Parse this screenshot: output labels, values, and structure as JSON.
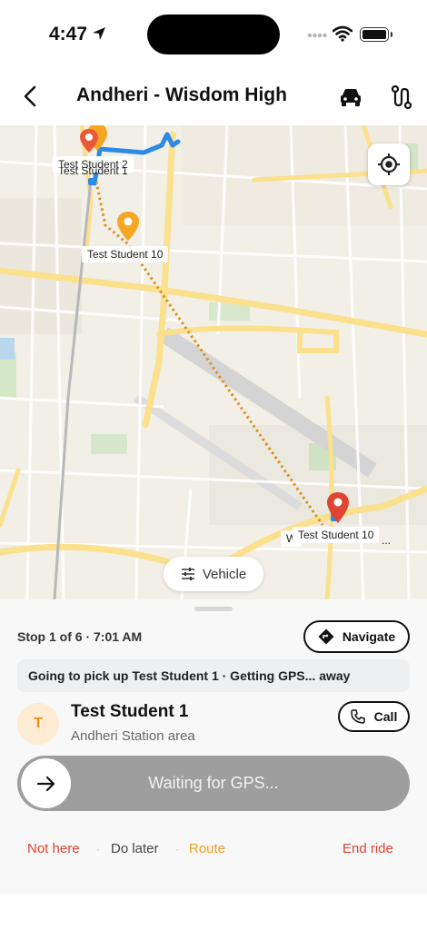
{
  "status_bar": {
    "time": "4:47"
  },
  "header": {
    "title": "Andheri - Wisdom High"
  },
  "map": {
    "labels": [
      "Test Student 2",
      "Test Student 1",
      "Test Student 10",
      "Test Student 10",
      "W",
      "..."
    ],
    "vehicle_chip": "Vehicle",
    "colors": {
      "route_blue": "#2a8ae6",
      "dotted_route": "#d9901f",
      "pin_orange": "#f5a623",
      "pin_red": "#e04432"
    }
  },
  "sheet": {
    "stop_info": "Stop 1 of 6 · 7:01 AM",
    "navigate_label": "Navigate",
    "banner": "Going to pick up Test Student 1 · Getting GPS... away",
    "avatar_initial": "T",
    "student_name": "Test Student 1",
    "student_area": "Andheri Station area",
    "call_label": "Call",
    "slider_text": "Waiting for GPS...",
    "actions": {
      "not_here": "Not here",
      "separator": "·",
      "do_later": "Do later",
      "route": "Route",
      "end_ride": "End ride"
    },
    "colors": {
      "not_here": "#e0432f",
      "do_later": "#444444",
      "route": "#f0a020",
      "end_ride": "#e0432f"
    }
  }
}
